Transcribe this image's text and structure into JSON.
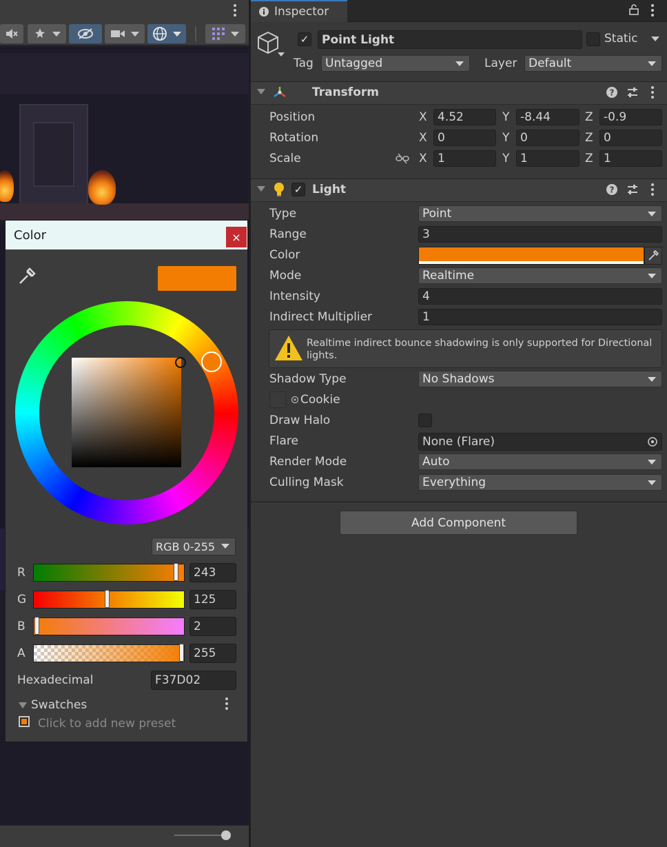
{
  "scene": {
    "toolbar_icons": [
      "kebab-icon",
      "audio-mute-icon",
      "effects-icon",
      "visibility-icon",
      "camera-icon",
      "gizmos-icon",
      "grid-icon"
    ]
  },
  "inspector": {
    "tab_label": "Inspector",
    "object": {
      "name": "Point Light",
      "active": true,
      "static_label": "Static",
      "tag_label": "Tag",
      "tag_value": "Untagged",
      "layer_label": "Layer",
      "layer_value": "Default"
    },
    "transform": {
      "title": "Transform",
      "rows": [
        {
          "label": "Position",
          "x": "4.52",
          "y": "-8.44",
          "z": "-0.9"
        },
        {
          "label": "Rotation",
          "x": "0",
          "y": "0",
          "z": "0"
        },
        {
          "label": "Scale",
          "x": "1",
          "y": "1",
          "z": "1"
        }
      ],
      "axis_x": "X",
      "axis_y": "Y",
      "axis_z": "Z"
    },
    "light": {
      "title": "Light",
      "enabled": true,
      "type_label": "Type",
      "type_value": "Point",
      "range_label": "Range",
      "range_value": "3",
      "color_label": "Color",
      "color_value": "#F37D02",
      "mode_label": "Mode",
      "mode_value": "Realtime",
      "intensity_label": "Intensity",
      "intensity_value": "4",
      "indirect_label": "Indirect Multiplier",
      "indirect_value": "1",
      "warning": "Realtime indirect bounce shadowing is only supported for Directional lights.",
      "shadow_label": "Shadow Type",
      "shadow_value": "No Shadows",
      "cookie_label": "Cookie",
      "halo_label": "Draw Halo",
      "flare_label": "Flare",
      "flare_value": "None (Flare)",
      "render_label": "Render Mode",
      "render_value": "Auto",
      "culling_label": "Culling Mask",
      "culling_value": "Everything"
    },
    "add_component": "Add Component"
  },
  "color_picker": {
    "title": "Color",
    "close": "×",
    "swatch_color": "#F37D02",
    "mode": "RGB 0-255",
    "r_label": "R",
    "r_value": "243",
    "g_label": "G",
    "g_value": "125",
    "b_label": "B",
    "b_value": "2",
    "a_label": "A",
    "a_value": "255",
    "hex_label": "Hexadecimal",
    "hex_value": "F37D02",
    "swatches_label": "Swatches",
    "preset_hint": "Click to add new preset"
  },
  "colors": {
    "accent": "#3a79bb",
    "orange": "#F37D02",
    "close_red": "#c42b31"
  }
}
